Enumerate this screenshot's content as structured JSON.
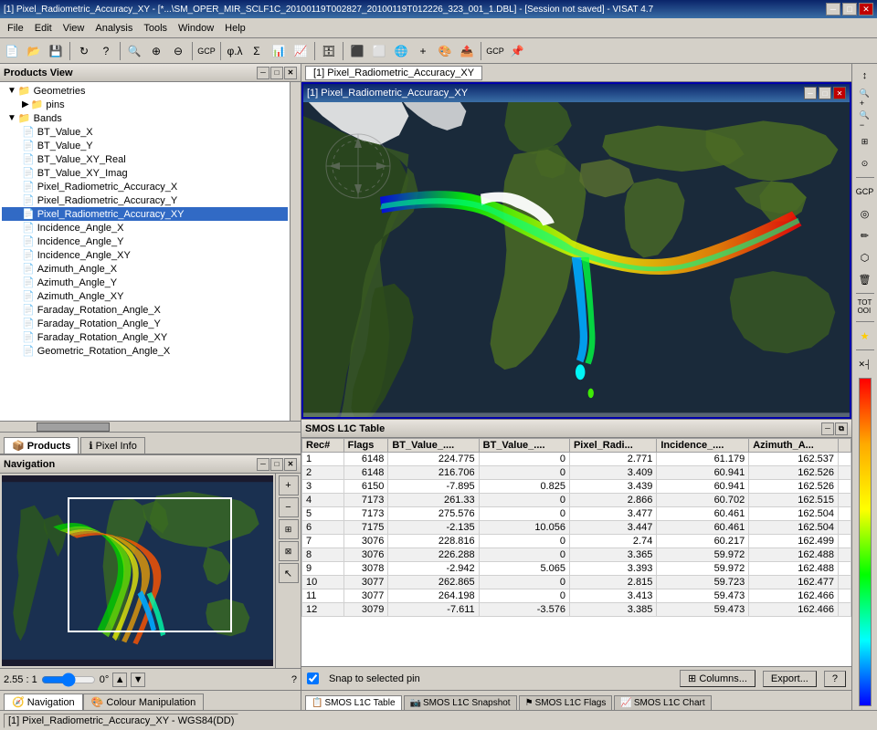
{
  "titleBar": {
    "title": "[1] Pixel_Radiometric_Accuracy_XY - [*...\\SM_OPER_MIR_SCLF1C_20100119T002827_20100119T012226_323_001_1.DBL] - [Session not saved] - VISAT 4.7",
    "minimize": "─",
    "maximize": "□",
    "close": "✕"
  },
  "menuBar": {
    "items": [
      "File",
      "Edit",
      "View",
      "Analysis",
      "Tools",
      "Window",
      "Help"
    ]
  },
  "productsView": {
    "title": "Products View",
    "tree": {
      "items": [
        {
          "id": "geometries",
          "label": "Geometries",
          "level": 1,
          "type": "folder",
          "expanded": true
        },
        {
          "id": "pins",
          "label": "pins",
          "level": 2,
          "type": "folder-pin",
          "expanded": false
        },
        {
          "id": "bands",
          "label": "Bands",
          "level": 1,
          "type": "folder",
          "expanded": true
        },
        {
          "id": "bt_value_x",
          "label": "BT_Value_X",
          "level": 2,
          "type": "file"
        },
        {
          "id": "bt_value_y",
          "label": "BT_Value_Y",
          "level": 2,
          "type": "file"
        },
        {
          "id": "bt_value_xy_real",
          "label": "BT_Value_XY_Real",
          "level": 2,
          "type": "file"
        },
        {
          "id": "bt_value_xy_imag",
          "label": "BT_Value_XY_Imag",
          "level": 2,
          "type": "file"
        },
        {
          "id": "pixel_rad_acc_x",
          "label": "Pixel_Radiometric_Accuracy_X",
          "level": 2,
          "type": "file"
        },
        {
          "id": "pixel_rad_acc_y",
          "label": "Pixel_Radiometric_Accuracy_Y",
          "level": 2,
          "type": "file"
        },
        {
          "id": "pixel_rad_acc_xy",
          "label": "Pixel_Radiometric_Accuracy_XY",
          "level": 2,
          "type": "file",
          "selected": true
        },
        {
          "id": "incidence_angle_x",
          "label": "Incidence_Angle_X",
          "level": 2,
          "type": "file"
        },
        {
          "id": "incidence_angle_y",
          "label": "Incidence_Angle_Y",
          "level": 2,
          "type": "file"
        },
        {
          "id": "incidence_angle_xy",
          "label": "Incidence_Angle_XY",
          "level": 2,
          "type": "file"
        },
        {
          "id": "azimuth_angle_x",
          "label": "Azimuth_Angle_X",
          "level": 2,
          "type": "file"
        },
        {
          "id": "azimuth_angle_y",
          "label": "Azimuth_Angle_Y",
          "level": 2,
          "type": "file"
        },
        {
          "id": "azimuth_angle_xy",
          "label": "Azimuth_Angle_XY",
          "level": 2,
          "type": "file"
        },
        {
          "id": "faraday_rot_x",
          "label": "Faraday_Rotation_Angle_X",
          "level": 2,
          "type": "file"
        },
        {
          "id": "faraday_rot_y",
          "label": "Faraday_Rotation_Angle_Y",
          "level": 2,
          "type": "file"
        },
        {
          "id": "faraday_rot_xy",
          "label": "Faraday_Rotation_Angle_XY",
          "level": 2,
          "type": "file"
        },
        {
          "id": "geometric_rot_x",
          "label": "Geometric_Rotation_Angle_X",
          "level": 2,
          "type": "file"
        }
      ]
    }
  },
  "bottomTabs": {
    "tabs": [
      {
        "id": "products",
        "label": "Products",
        "icon": "📦",
        "active": true
      },
      {
        "id": "pixel-info",
        "label": "Pixel Info",
        "icon": "ℹ",
        "active": false
      }
    ]
  },
  "navigation": {
    "title": "Navigation",
    "zoom": "2.55 : 1",
    "rotation": "0°",
    "tabs": [
      {
        "id": "navigation",
        "label": "Navigation",
        "icon": "🧭",
        "active": true
      },
      {
        "id": "colour-manipulation",
        "label": "Colour Manipulation",
        "icon": "🎨",
        "active": false
      }
    ]
  },
  "imageWindow": {
    "title": "[1] Pixel_Radiometric_Accuracy_XY",
    "tabTitle": "[1] Pixel_Radiometric_Accuracy_XY"
  },
  "rightSidebar": {
    "buttons": [
      "↕",
      "🔍+",
      "🔍-",
      "🔍□",
      "🔍○",
      "+",
      "◎",
      "✏",
      "⬡",
      "🗑",
      "TOT\nOOI",
      "★",
      "✕┤"
    ]
  },
  "table": {
    "title": "SMOS L1C Table",
    "columns": [
      "Rec#",
      "Flags",
      "BT_Value_....",
      "BT_Value_....",
      "Pixel_Radi...",
      "Incidence_...",
      "Azimuth_A...",
      ""
    ],
    "rows": [
      {
        "rec": "1",
        "flags": "6148",
        "bt1": "224.775",
        "bt2": "0",
        "pixel": "2.771",
        "incidence": "61.179",
        "azimuth": "162.537"
      },
      {
        "rec": "2",
        "flags": "6148",
        "bt1": "216.706",
        "bt2": "0",
        "pixel": "3.409",
        "incidence": "60.941",
        "azimuth": "162.526"
      },
      {
        "rec": "3",
        "flags": "6150",
        "bt1": "-7.895",
        "bt2": "0.825",
        "pixel": "3.439",
        "incidence": "60.941",
        "azimuth": "162.526"
      },
      {
        "rec": "4",
        "flags": "7173",
        "bt1": "261.33",
        "bt2": "0",
        "pixel": "2.866",
        "incidence": "60.702",
        "azimuth": "162.515"
      },
      {
        "rec": "5",
        "flags": "7173",
        "bt1": "275.576",
        "bt2": "0",
        "pixel": "3.477",
        "incidence": "60.461",
        "azimuth": "162.504"
      },
      {
        "rec": "6",
        "flags": "7175",
        "bt1": "-2.135",
        "bt2": "10.056",
        "pixel": "3.447",
        "incidence": "60.461",
        "azimuth": "162.504"
      },
      {
        "rec": "7",
        "flags": "3076",
        "bt1": "228.816",
        "bt2": "0",
        "pixel": "2.74",
        "incidence": "60.217",
        "azimuth": "162.499"
      },
      {
        "rec": "8",
        "flags": "3076",
        "bt1": "226.288",
        "bt2": "0",
        "pixel": "3.365",
        "incidence": "59.972",
        "azimuth": "162.488"
      },
      {
        "rec": "9",
        "flags": "3078",
        "bt1": "-2.942",
        "bt2": "5.065",
        "pixel": "3.393",
        "incidence": "59.972",
        "azimuth": "162.488"
      },
      {
        "rec": "10",
        "flags": "3077",
        "bt1": "262.865",
        "bt2": "0",
        "pixel": "2.815",
        "incidence": "59.723",
        "azimuth": "162.477"
      },
      {
        "rec": "11",
        "flags": "3077",
        "bt1": "264.198",
        "bt2": "0",
        "pixel": "3.413",
        "incidence": "59.473",
        "azimuth": "162.466"
      },
      {
        "rec": "12",
        "flags": "3079",
        "bt1": "-7.611",
        "bt2": "-3.576",
        "pixel": "3.385",
        "incidence": "59.473",
        "azimuth": "162.466"
      }
    ],
    "snapLabel": "Snap to selected pin",
    "columnsBtn": "⊞ Columns...",
    "exportBtn": "Export...",
    "helpBtn": "?",
    "tabs": [
      {
        "id": "table",
        "label": "SMOS L1C Table",
        "icon": "📋",
        "active": true
      },
      {
        "id": "snapshot",
        "label": "SMOS L1C Snapshot",
        "icon": "📷",
        "active": false
      },
      {
        "id": "flags",
        "label": "SMOS L1C Flags",
        "icon": "⚑",
        "active": false
      },
      {
        "id": "chart",
        "label": "SMOS L1C Chart",
        "icon": "📈",
        "active": false
      }
    ]
  },
  "statusBar": {
    "text": "[1] Pixel_Radiometric_Accuracy_XY - WGS84(DD)"
  }
}
